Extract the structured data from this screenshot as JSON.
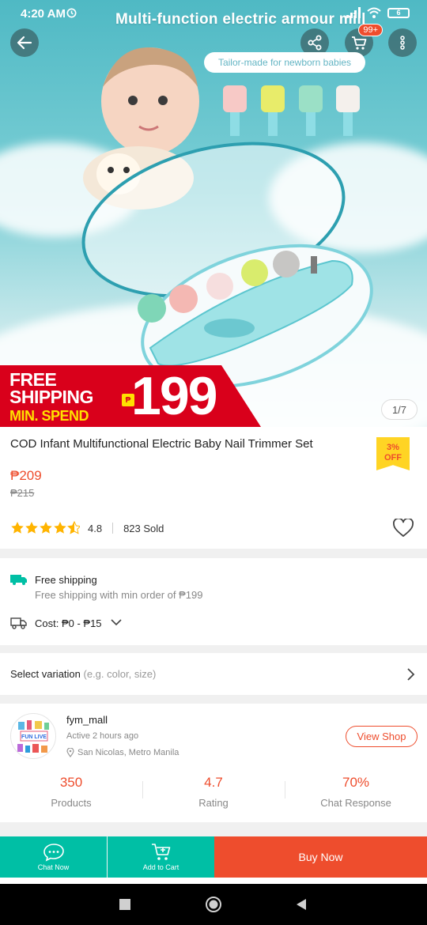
{
  "status_bar": {
    "time": "4:20 AM",
    "battery": "6"
  },
  "hero": {
    "title": "Multi-function electric armour mill",
    "tagline": "Tailor-made for newborn babies",
    "cart_badge": "99+",
    "image_counter": "1/7",
    "promo": {
      "line1": "FREE",
      "line2": "SHIPPING",
      "line3": "MIN. SPEND",
      "amount": "199",
      "currency": "₱"
    }
  },
  "product": {
    "title": "COD Infant Multifunctional Electric Baby Nail Trimmer Set",
    "price": "₱209",
    "original_price": "₱215",
    "discount_pct": "3%",
    "discount_off": "OFF",
    "rating": "4.8",
    "rating_stars": 4.5,
    "sold": "823 Sold"
  },
  "shipping": {
    "free_label": "Free shipping",
    "free_sub": "Free shipping with min order of ₱199",
    "cost_label": "Cost: ₱0 - ₱15"
  },
  "variation": {
    "label": "Select variation",
    "hint": "(e.g. color, size)"
  },
  "shop": {
    "name": "fym_mall",
    "active": "Active 2 hours ago",
    "location": "San Nicolas, Metro Manila",
    "view_shop": "View Shop",
    "avatar_text": "FUN LIVE",
    "stats": [
      {
        "value": "350",
        "label": "Products"
      },
      {
        "value": "4.7",
        "label": "Rating"
      },
      {
        "value": "70%",
        "label": "Chat Response"
      }
    ]
  },
  "actions": {
    "chat": "Chat Now",
    "add_cart": "Add to Cart",
    "buy": "Buy Now"
  },
  "colors": {
    "accent": "#ee4d2d",
    "teal": "#00bfa5",
    "promo_red": "#d9001b",
    "star": "#ffb400"
  }
}
